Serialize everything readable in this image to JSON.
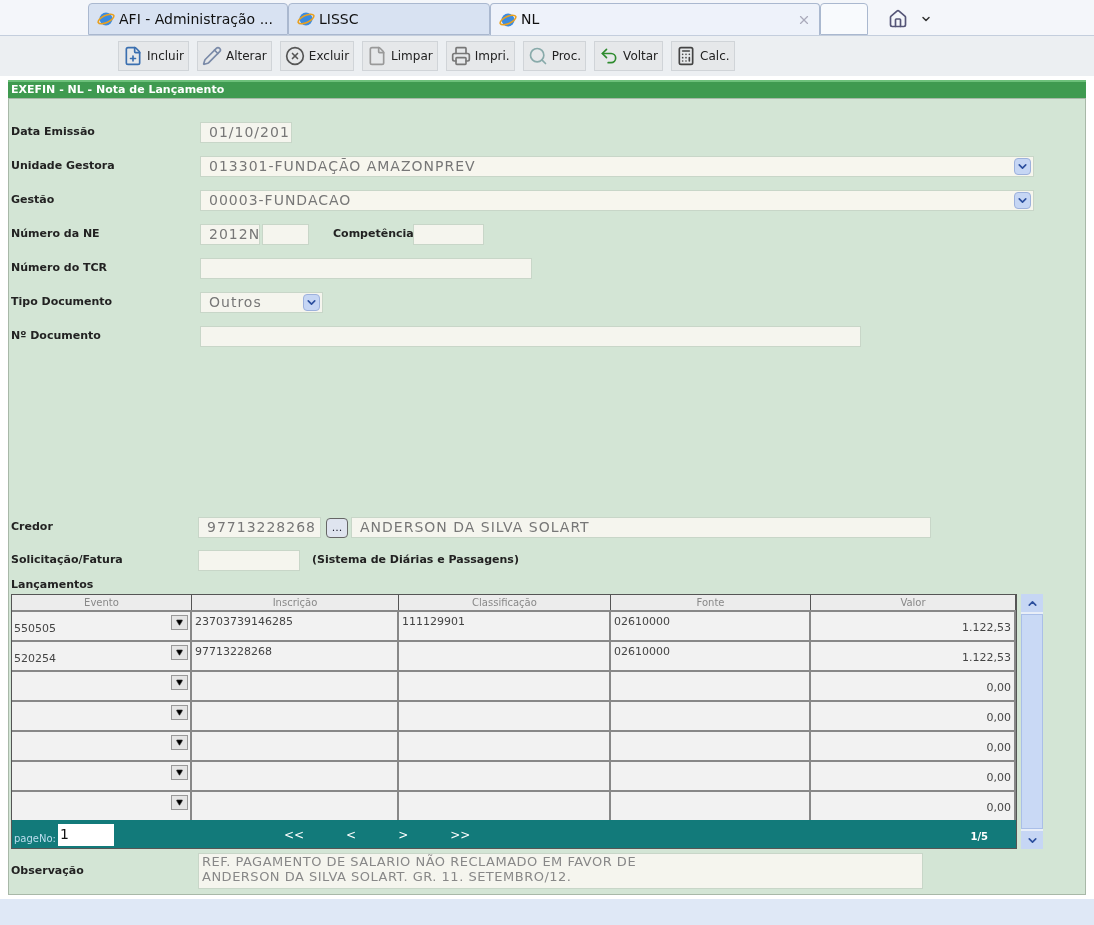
{
  "browser_tabs": [
    {
      "label": "AFI - Administração ...",
      "selected": false
    },
    {
      "label": "LISSC",
      "selected": false
    },
    {
      "label": "NL",
      "selected": true
    }
  ],
  "toolbar": [
    "Incluir",
    "Alterar",
    "Excluir",
    "Limpar",
    "Impri.",
    "Proc.",
    "Voltar",
    "Calc."
  ],
  "form": {
    "title": "EXEFIN - NL - Nota de Lançamento",
    "fields": [
      {
        "kind": "date",
        "label": "Data Emissão",
        "value": "01/10/201"
      },
      {
        "kind": "select",
        "label": "Unidade Gestora",
        "value": "013301-FUNDAÇÃO AMAZONPREV"
      },
      {
        "kind": "select",
        "label": "Gestão",
        "value": "00003-FUNDACAO"
      },
      {
        "kind": "ne",
        "label": "Número da NE",
        "value": "2012N",
        "extra_label": "Competência"
      },
      {
        "kind": "medium",
        "label": "Número do TCR"
      },
      {
        "kind": "small-select",
        "label": "Tipo Documento",
        "value": "Outros"
      },
      {
        "kind": "long",
        "label": "Nº Documento"
      }
    ],
    "credor": {
      "label": "Credor",
      "code": "97713228268",
      "button": "...",
      "name": "ANDERSON DA SILVA SOLART"
    },
    "solicitacao": {
      "label": "Solicitação/Fatura",
      "note": "(Sistema de Diárias e Passagens)"
    },
    "lancamentos": {
      "title": "Lançamentos",
      "columns": [
        "Evento",
        "Inscrição",
        "Classificação",
        "Fonte",
        "Valor"
      ],
      "rows": [
        {
          "evento": "550505",
          "inscricao": "23703739146285",
          "classificacao": "111129901",
          "fonte": "02610000",
          "valor": "1.122,53"
        },
        {
          "evento": "520254",
          "inscricao": "97713228268",
          "fonte": "02610000",
          "valor": "1.122,53"
        },
        {
          "valor": "0,00"
        },
        {
          "valor": "0,00"
        },
        {
          "valor": "0,00"
        },
        {
          "valor": "0,00"
        },
        {
          "valor": "0,00"
        }
      ],
      "pager": {
        "label": "pageNo:",
        "page": "1",
        "buttons": [
          "<<",
          "<",
          ">",
          ">>"
        ],
        "count": "1/5"
      }
    },
    "observacao": {
      "label": "Observação",
      "value": "REF. PAGAMENTO DE SALARIO NÃO RECLAMADO EM FAVOR DE\nANDERSON DA SILVA SOLART. GR. 11. SETEMBRO/12."
    }
  }
}
